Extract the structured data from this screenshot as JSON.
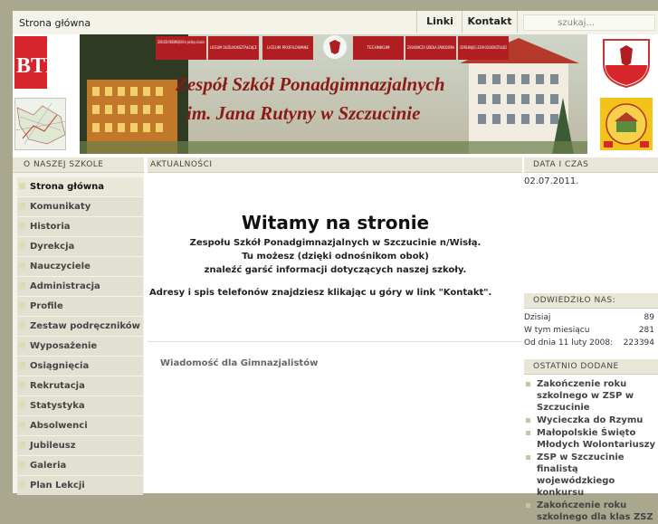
{
  "topbar": {
    "breadcrumb": "Strona główna",
    "links": [
      "Linki",
      "Kontakt"
    ],
    "search_placeholder": "szukaj..."
  },
  "header": {
    "logo_text": "BTP",
    "banner_signs": [
      "ZESPÓŁ SZKÓŁ PONADGIMNAZJALNYCH im. Jana Rutyny w Szczucinie",
      "LICEUM OGÓLNOKSZTAŁCĄCE",
      "LICEUM PROFILOWANE",
      "TECHNIKUM",
      "ZASADNICZA SZKOŁA ZAWODOWA",
      "UZUPEŁNIAJĄCE LICEUM OGÓLNOKSZTAŁCĄCE"
    ],
    "banner_title_1": "Zespół Szkół Ponadgimnazjalnych",
    "banner_title_2": "im. Jana Rutyny w Szczucinie"
  },
  "left": {
    "heading": "O NASZEJ SZKOLE",
    "items": [
      "Strona główna",
      "Komunikaty",
      "Historia",
      "Dyrekcja",
      "Nauczyciele",
      "Administracja",
      "Profile",
      "Zestaw podręczników",
      "Wyposażenie",
      "Osiągnięcia",
      "Rekrutacja",
      "Statystyka",
      "Absolwenci",
      "Jubileusz",
      "Galeria",
      "Plan Lekcji"
    ]
  },
  "center": {
    "heading": "AKTUALNOŚCI",
    "welcome": "Witamy na stronie",
    "intro_lines": [
      "Zespołu Szkół Ponadgimnazjalnych w Szczucinie n/Wisłą.",
      "Tu możesz (dzięki odnośnikom obok)",
      "znaleźć garść informacji dotyczących naszej szkoły."
    ],
    "address_note": "Adresy i spis telefonów znajdziesz klikając u góry w link \"Kontakt\".",
    "news_link": "Wiadomość dla Gimnazjalistów"
  },
  "right": {
    "date_heading": "DATA I CZAS",
    "date": "02.07.2011.",
    "visits_heading": "ODWIEDZIŁO NAS:",
    "visits": [
      {
        "label": "Dzisiaj",
        "value": "89"
      },
      {
        "label": "W tym miesiącu",
        "value": "281"
      },
      {
        "label": "Od dnia 11 luty 2008:",
        "value": "223394"
      }
    ],
    "recent_heading": "OSTATNIO DODANE",
    "recent_items": [
      "Zakończenie roku szkolnego w ZSP w Szczucinie",
      "Wycieczka do Rzymu",
      "Małopolskie Święto Młodych Wolontariuszy",
      "ZSP w Szczucinie finalistą wojewódzkiego konkursu",
      "Zakończenie roku szkolnego dla klas ZSZ"
    ]
  },
  "colors": {
    "page_bg": "#a9a88e",
    "section_head": "#e7e6d7",
    "nav_item": "#e2e1d1",
    "banner_red": "#b01e22"
  }
}
